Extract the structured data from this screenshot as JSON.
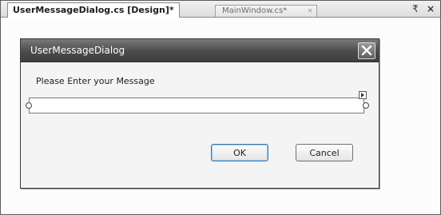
{
  "tabs": {
    "active_label": "UserMessageDialog.cs [Design]*",
    "inactive_label": "MainWindow.cs*",
    "inactive_close": "×",
    "dropdown_glyph": "₹",
    "close_glyph": "×"
  },
  "dialog": {
    "title": "UserMessageDialog",
    "prompt": "Please Enter your Message",
    "input_value": "",
    "ok_label": "OK",
    "cancel_label": "Cancel"
  },
  "icons": {
    "dialog_close": "close-icon",
    "smart_tag": "smart-tag-arrow-icon",
    "tab_dropdown": "dropdown-icon",
    "tab_close": "close-icon"
  },
  "colors": {
    "titlebar_top": "#7a7a7a",
    "titlebar_bottom": "#3f3f3f",
    "dialog_body": "#f4f4f4",
    "default_button_border": "#3c7fb1"
  }
}
